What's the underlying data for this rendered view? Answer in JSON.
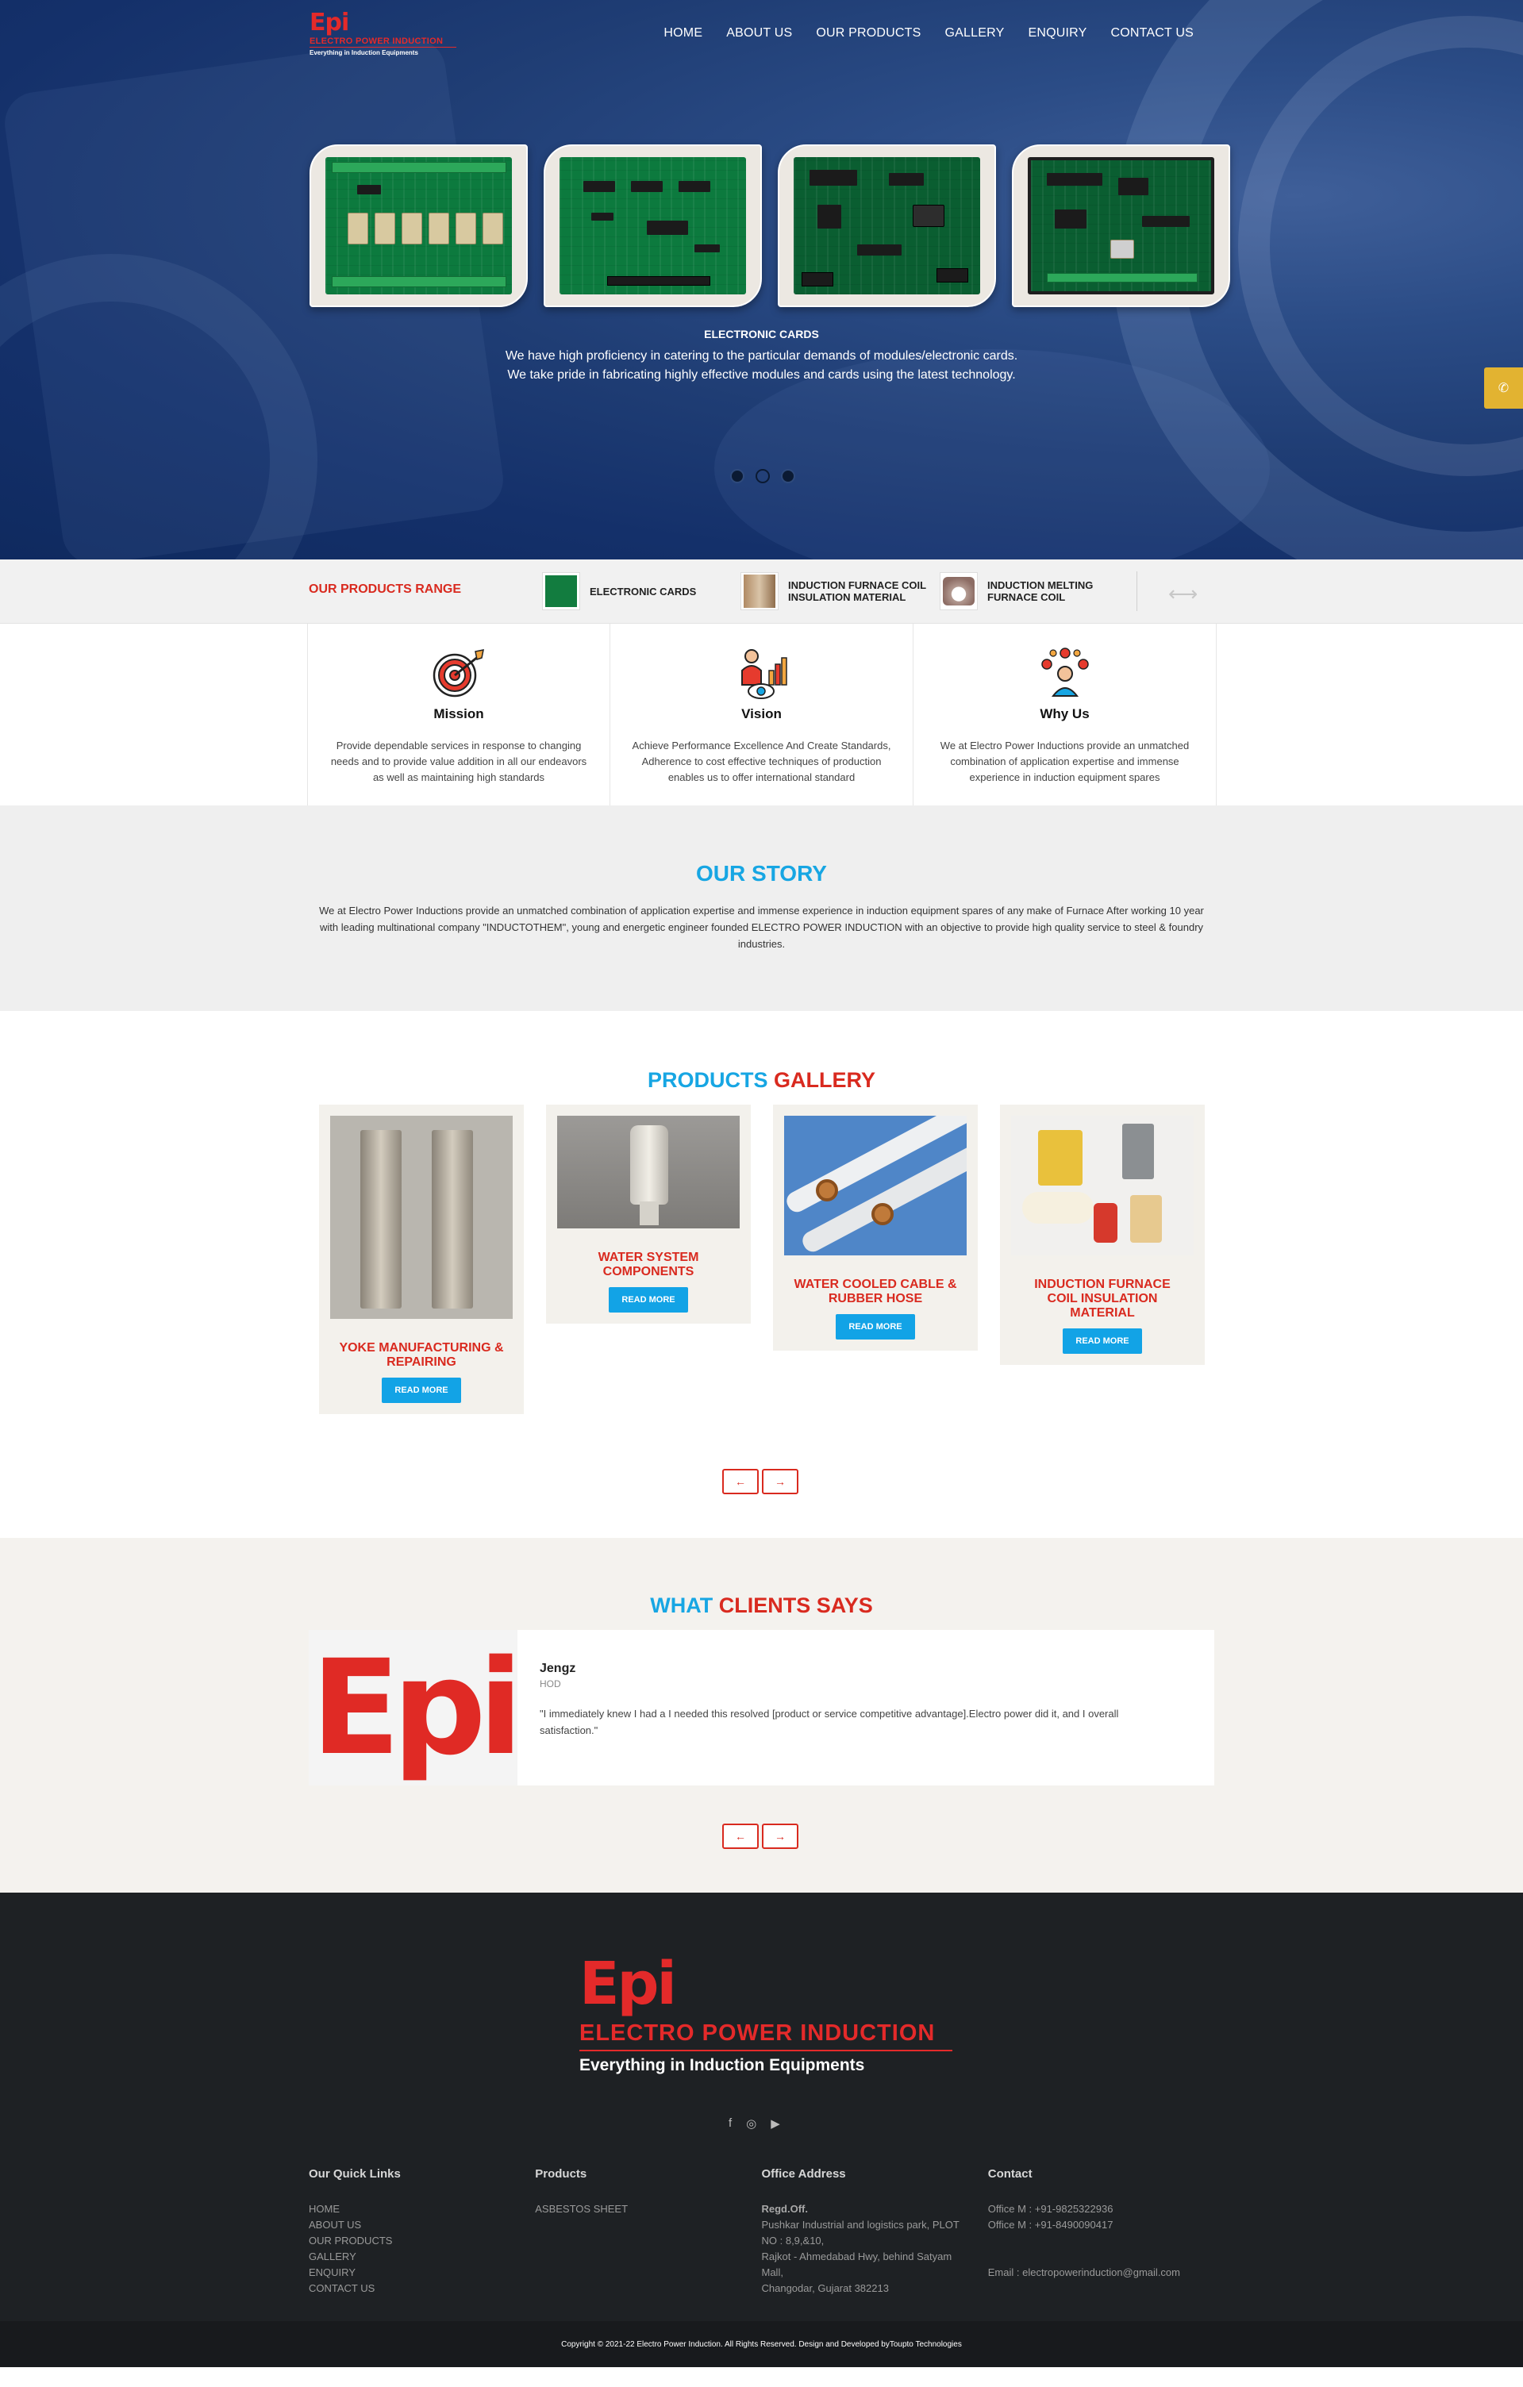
{
  "brand": {
    "mark": "Epi",
    "name": "ELECTRO POWER INDUCTION",
    "tagline": "Everything in Induction Equipments"
  },
  "nav": {
    "items": [
      {
        "label": "HOME"
      },
      {
        "label": "ABOUT US"
      },
      {
        "label": "OUR PRODUCTS"
      },
      {
        "label": "GALLERY"
      },
      {
        "label": "ENQUIRY"
      },
      {
        "label": "CONTACT US"
      }
    ]
  },
  "hero": {
    "title": "ELECTRONIC CARDS",
    "line1": "We have high proficiency in catering to the particular demands of modules/electronic cards.",
    "line2": "We take pride in fabricating highly effective modules and cards using the latest technology.",
    "active_slide": 2,
    "slides": 3
  },
  "whatsapp_icon": "whatsapp-icon",
  "range": {
    "title": "OUR PRODUCTS RANGE",
    "items": [
      {
        "label": "ELECTRONIC CARDS"
      },
      {
        "label1": "INDUCTION FURNACE COIL",
        "label2": "INSULATION MATERIAL"
      },
      {
        "label1": "INDUCTION MELTING",
        "label2": "FURNACE COIL"
      }
    ]
  },
  "features": [
    {
      "title": "Mission",
      "icon": "target-icon",
      "text": "Provide dependable services in response to changing needs and to provide value addition in all our endeavors as well as maintaining high standards"
    },
    {
      "title": "Vision",
      "icon": "vision-icon",
      "text": "Achieve Performance Excellence And Create Standards, Adherence to cost effective techniques of production enables us to offer international standard"
    },
    {
      "title": "Why Us",
      "icon": "team-icon",
      "text": "We at Electro Power Inductions provide an unmatched combination of application expertise and immense experience in induction equipment spares"
    }
  ],
  "story": {
    "title": "OUR STORY",
    "text": "We at Electro Power Inductions provide an unmatched combination of application expertise and immense experience in induction equipment spares of any make of Furnace After working 10 year with leading multinational company \"INDUCTOTHEM\", young and energetic engineer founded ELECTRO POWER INDUCTION with an objective to provide high quality service to steel & foundry industries."
  },
  "gallery": {
    "title_a": "PRODUCTS",
    "title_b": "GALLERY",
    "items": [
      {
        "title": "YOKE MANUFACTURING & REPAIRING",
        "button": "READ MORE"
      },
      {
        "title": "WATER SYSTEM COMPONENTS",
        "button": "READ MORE"
      },
      {
        "title": "WATER COOLED CABLE & RUBBER HOSE",
        "button": "READ MORE"
      },
      {
        "title": "INDUCTION FURNACE COIL INSULATION MATERIAL",
        "button": "READ MORE"
      }
    ],
    "prev": "←",
    "next": "→"
  },
  "clients": {
    "title_a": "WHAT",
    "title_b": "CLIENTS SAYS",
    "logo": "Epi",
    "name": "Jengz",
    "role": "HOD",
    "quote": "\"I immediately knew I had a I needed this resolved [product or service competitive advantage].Electro power did it, and I overall satisfaction.\"",
    "prev": "←",
    "next": "→"
  },
  "footer": {
    "social": [
      "f",
      "◎",
      "▶"
    ],
    "quick_links": {
      "title": "Our Quick Links",
      "items": [
        "HOME",
        "ABOUT US",
        "OUR PRODUCTS",
        "GALLERY",
        "ENQUIRY",
        "CONTACT US"
      ]
    },
    "products": {
      "title": "Products",
      "items": [
        "ASBESTOS SHEET"
      ]
    },
    "address": {
      "title": "Office Address",
      "label": "Regd.Off.",
      "lines": [
        "Pushkar Industrial and logistics park, PLOT",
        "NO : 8,9,&10,",
        "Rajkot - Ahmedabad Hwy, behind Satyam",
        "Mall,",
        "Changodar, Gujarat 382213"
      ]
    },
    "contact": {
      "title": "Contact",
      "phone1": "Office M : +91-9825322936",
      "phone2": "Office M : +91-8490090417",
      "email": "Email : electropowerinduction@gmail.com"
    },
    "copyright": "Copyright © 2021-22 Electro Power Induction. All Rights Reserved. Design and Developed byToupto Technologies"
  },
  "colors": {
    "accent_red": "#d92a1f",
    "accent_blue": "#17a6e3",
    "hero_blue": "#1b3b72",
    "footer_bg": "#1e2124",
    "whatsapp": "#e2b331"
  }
}
